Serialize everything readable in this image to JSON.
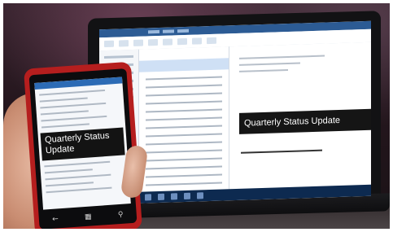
{
  "photo": {
    "subject": "hand holding phone in front of laptop showing email"
  },
  "laptop": {
    "banner_text": "Quarterly Status Update"
  },
  "phone": {
    "banner_line1": "Quarterly Status",
    "banner_line2": "Update",
    "nav_icons": [
      "back-icon",
      "windows-icon",
      "search-icon"
    ]
  },
  "colors": {
    "phone_body": "#b51e1e",
    "outlook_blue": "#2c5b94",
    "banner_black": "#151515"
  }
}
